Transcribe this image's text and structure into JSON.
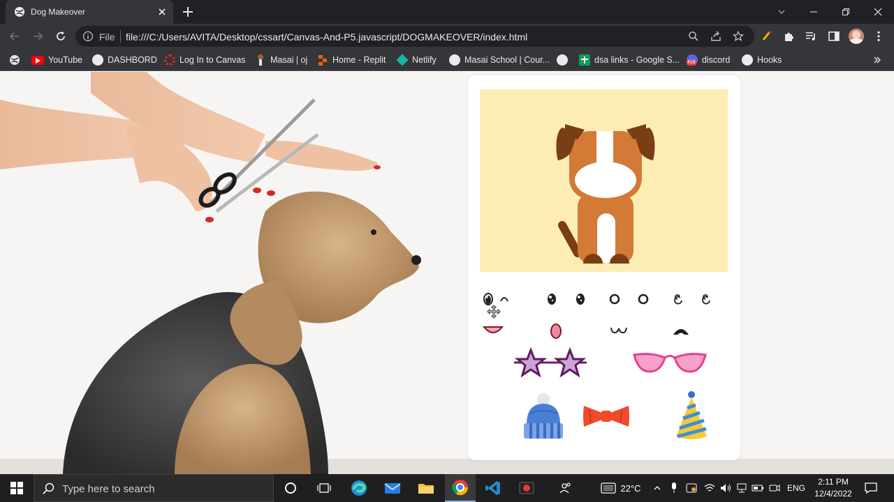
{
  "browser": {
    "tab_title": "Dog Makeover",
    "address_scheme": "File",
    "address_url": "file:///C:/Users/AVITA/Desktop/cssart/Canvas-And-P5.javascript/DOGMAKEOVER/index.html"
  },
  "bookmarks": [
    {
      "label": "YouTube",
      "icon": "youtube-icon",
      "color": "#ff0000"
    },
    {
      "label": "DASHBORD",
      "icon": "globe-icon",
      "color": "#e8eaed"
    },
    {
      "label": "Log In to Canvas",
      "icon": "canvas-icon",
      "color": "#e4262b"
    },
    {
      "label": "Masai | oj",
      "icon": "masai-icon",
      "color": "#e8eaed"
    },
    {
      "label": "Home - Replit",
      "icon": "replit-icon",
      "color": "#f26207"
    },
    {
      "label": "Netlify",
      "icon": "netlify-icon",
      "color": "#15b5a8"
    },
    {
      "label": "Masai School | Cour...",
      "icon": "globe-icon",
      "color": "#e8eaed"
    },
    {
      "label": "",
      "icon": "globe-icon",
      "color": "#e8eaed"
    },
    {
      "label": "dsa links - Google S...",
      "icon": "sheets-icon",
      "color": "#0f9d58"
    },
    {
      "label": "discord",
      "icon": "discord-icon",
      "color": "#5865f2",
      "badge": "418"
    },
    {
      "label": "Hooks",
      "icon": "globe-icon",
      "color": "#e8eaed"
    }
  ],
  "colors": {
    "canvas_bg": "#fdedb5",
    "dog_body": "#d27a36",
    "dog_ears": "#7a3e14",
    "dog_white": "#ffffff",
    "glasses_pink": "#f6a1c9",
    "star_purple": "#c9a6d6",
    "bowtie_red": "#f04a2b",
    "beanie_blue": "#4a7fd8",
    "party_hat_yellow": "#f7c934"
  },
  "parts": {
    "eyes": [
      "eyes-round-shiny",
      "eyes-closed-arc",
      "eyes-shiny-pair",
      "eyes-open-circles",
      "eyes-spiral"
    ],
    "mouths": [
      "mouth-smile-tongue",
      "mouth-pink-oval",
      "mouth-cat-w",
      "mouth-open-dark"
    ],
    "accessories": [
      "star-glasses",
      "pink-cat-eye-glasses",
      "blue-beanie",
      "red-bowtie",
      "party-hat"
    ]
  },
  "taskbar": {
    "search_placeholder": "Type here to search",
    "weather": "22°C",
    "language": "ENG",
    "time": "2:11 PM",
    "date": "12/4/2022"
  }
}
